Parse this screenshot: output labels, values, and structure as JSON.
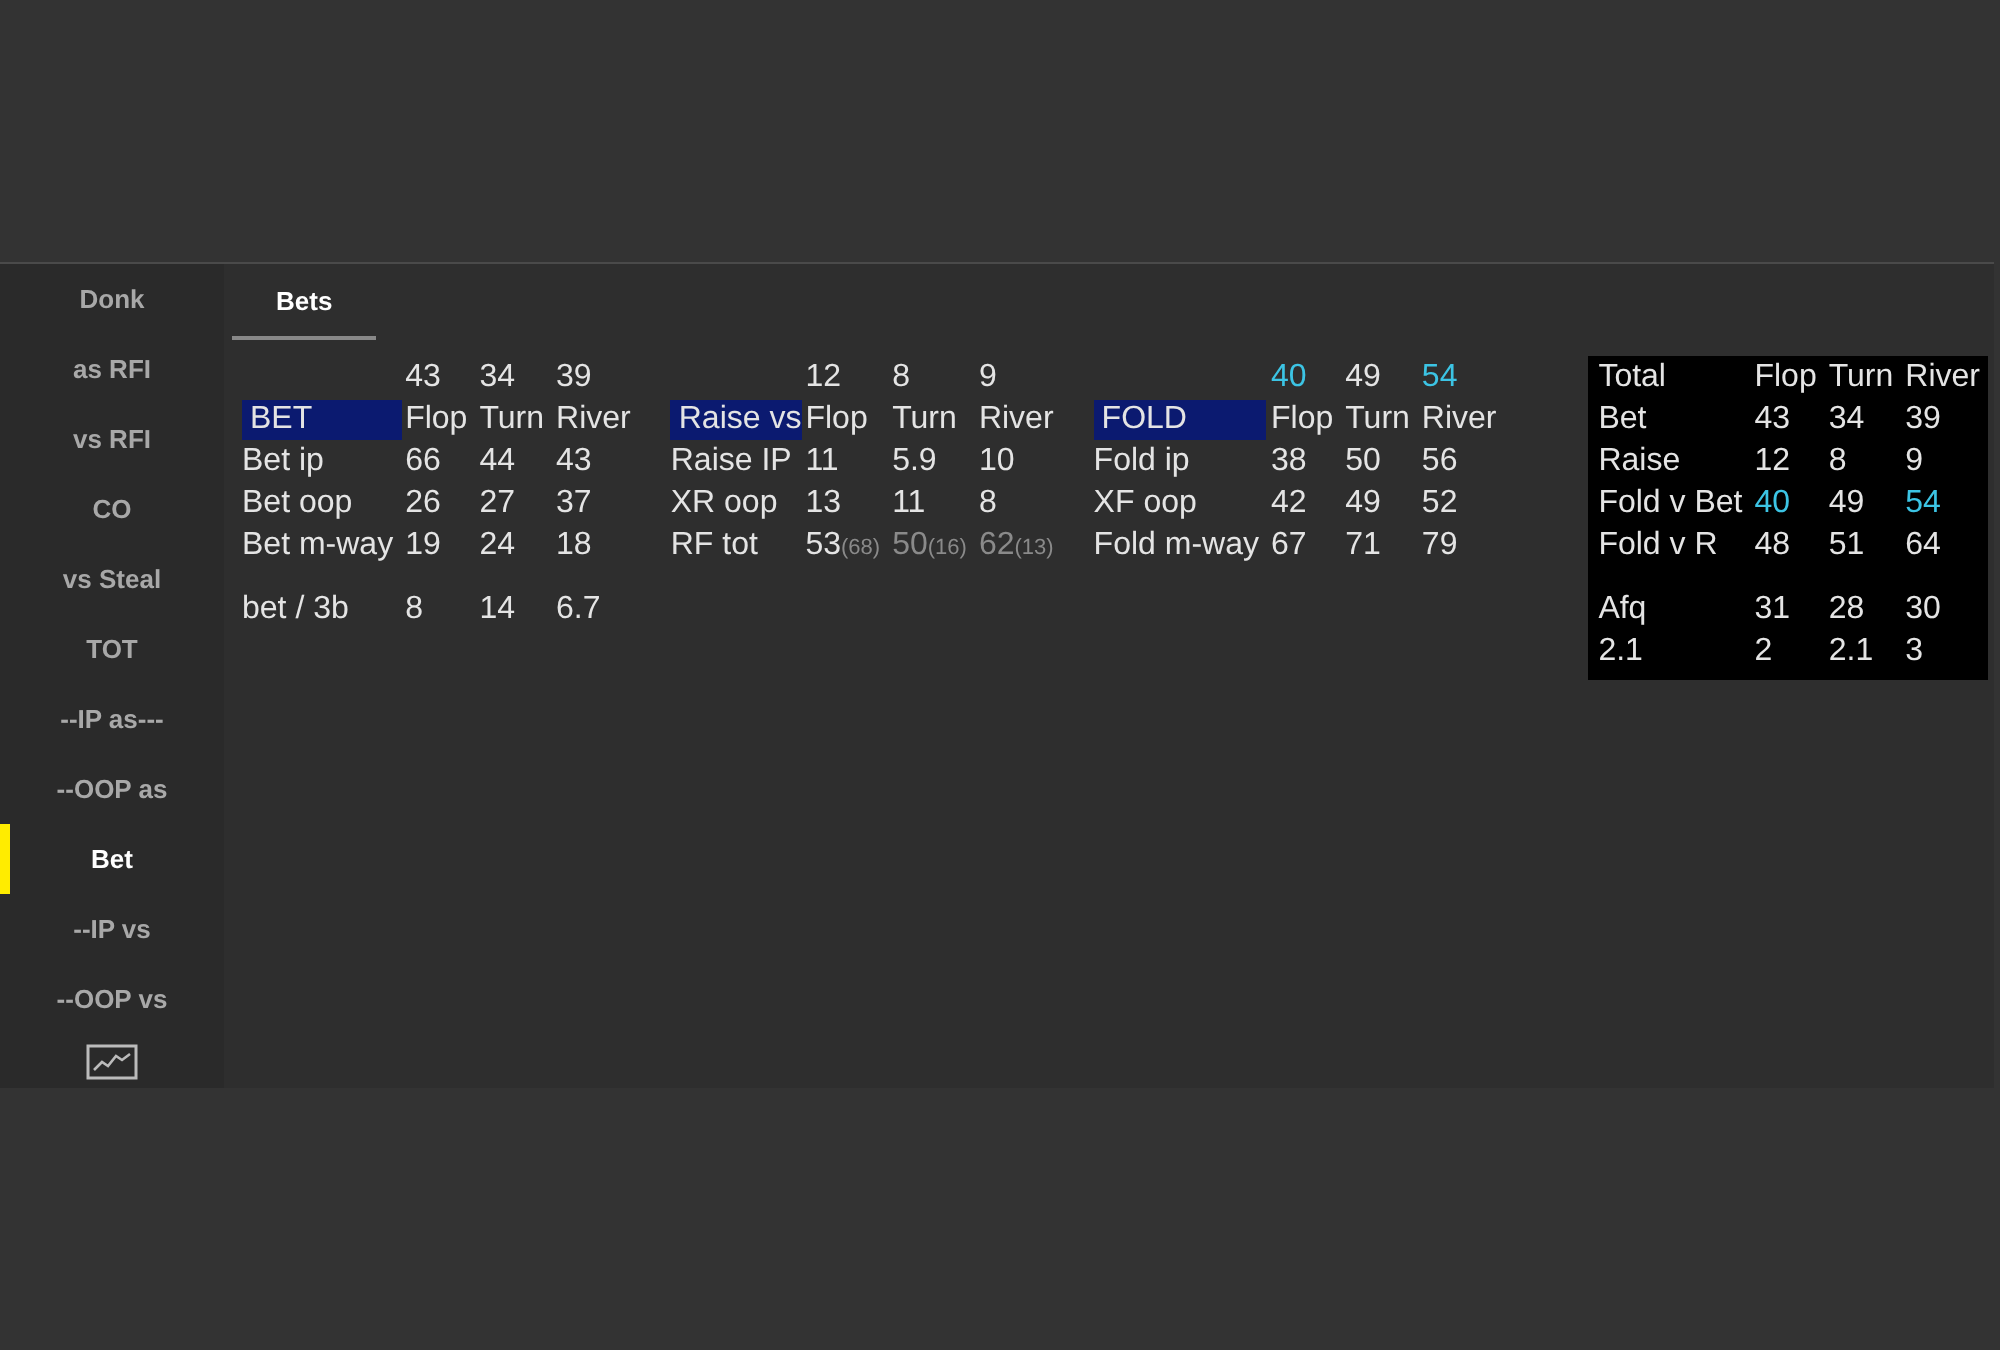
{
  "sidebar": {
    "items": [
      {
        "label": "Donk",
        "selected": false
      },
      {
        "label": "as RFI",
        "selected": false
      },
      {
        "label": "vs RFI",
        "selected": false
      },
      {
        "label": "CO",
        "selected": false
      },
      {
        "label": "vs Steal",
        "selected": false
      },
      {
        "label": "TOT",
        "selected": false
      },
      {
        "label": "--IP as---",
        "selected": false
      },
      {
        "label": "--OOP as",
        "selected": false
      },
      {
        "label": "Bet",
        "selected": true
      },
      {
        "label": "--IP vs",
        "selected": false
      },
      {
        "label": "--OOP vs",
        "selected": false
      }
    ]
  },
  "tabs": [
    {
      "label": "Bets",
      "selected": true
    }
  ],
  "sections": [
    {
      "totals": [
        "43",
        "34",
        "39"
      ],
      "title": "BET",
      "columns": [
        "Flop",
        "Turn",
        "River"
      ],
      "rows": [
        {
          "label": "Bet ip",
          "cells": [
            "66",
            "44",
            "43"
          ]
        },
        {
          "label": "Bet oop",
          "cells": [
            "26",
            "27",
            "37"
          ]
        },
        {
          "label": "Bet m-way",
          "cells": [
            "19",
            "24",
            "18"
          ]
        }
      ],
      "extra_rows": [
        {
          "label": "bet / 3b",
          "cells": [
            "8",
            "14",
            "6.7"
          ]
        }
      ]
    },
    {
      "totals": [
        "12",
        "8",
        "9"
      ],
      "title": "Raise vs",
      "columns": [
        "Flop",
        "Turn",
        "River"
      ],
      "rows": [
        {
          "label": "Raise IP",
          "cells": [
            "11",
            "5.9",
            "10"
          ]
        },
        {
          "label": "XR oop",
          "cells": [
            "13",
            "11",
            "8"
          ]
        },
        {
          "label": "RF tot",
          "cells": [
            {
              "value": "53",
              "sample": "(68)",
              "dim": false
            },
            {
              "value": "50",
              "sample": "(16)",
              "dim": true
            },
            {
              "value": "62",
              "sample": "(13)",
              "dim": true
            }
          ]
        }
      ]
    },
    {
      "totals": [
        {
          "value": "40",
          "highlight": true
        },
        "49",
        {
          "value": "54",
          "highlight": true
        }
      ],
      "title": "FOLD",
      "columns": [
        "Flop",
        "Turn",
        "River"
      ],
      "rows": [
        {
          "label": "Fold ip",
          "cells": [
            "38",
            "50",
            "56"
          ]
        },
        {
          "label": "XF oop",
          "cells": [
            "42",
            "49",
            "52"
          ]
        },
        {
          "label": "Fold m-way",
          "cells": [
            "67",
            "71",
            "79"
          ]
        }
      ]
    }
  ],
  "total_table": {
    "corner_label": "Total",
    "columns": [
      "Flop",
      "Turn",
      "River"
    ],
    "rows": [
      {
        "label": "Bet",
        "cells": [
          "43",
          "34",
          "39"
        ]
      },
      {
        "label": "Raise",
        "cells": [
          "12",
          "8",
          "9"
        ]
      },
      {
        "label": "Fold v Bet",
        "cells": [
          {
            "value": "40",
            "highlight": true
          },
          "49",
          {
            "value": "54",
            "highlight": true
          }
        ]
      },
      {
        "label": "Fold v R",
        "cells": [
          "48",
          "51",
          "64"
        ]
      }
    ],
    "extra_rows": [
      {
        "label": "Afq",
        "cells": [
          "31",
          "28",
          "30"
        ]
      },
      {
        "label": "2.1",
        "cells": [
          "2",
          "2.1",
          "3"
        ]
      }
    ]
  }
}
